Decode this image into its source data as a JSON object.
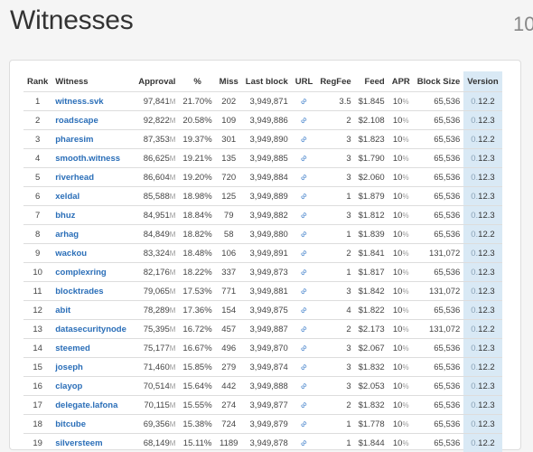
{
  "header": {
    "title": "Witnesses",
    "count": "10"
  },
  "columns": {
    "rank": "Rank",
    "witness": "Witness",
    "approval": "Approval",
    "pct": "%",
    "miss": "Miss",
    "last_block": "Last block",
    "url": "URL",
    "regfee": "RegFee",
    "feed": "Feed",
    "apr": "APR",
    "block_size": "Block Size",
    "version": "Version"
  },
  "rows": [
    {
      "rank": "1",
      "name": "witness.svk",
      "approval": "97,841",
      "unit": "M",
      "pct": "21.70%",
      "miss": "202",
      "last_block": "3,949,871",
      "regfee": "3.5",
      "feed": "$1.845",
      "apr": "10",
      "apr_unit": "%",
      "block_size": "65,536",
      "ver_major": "0.",
      "ver_minor": "12.2"
    },
    {
      "rank": "2",
      "name": "roadscape",
      "approval": "92,822",
      "unit": "M",
      "pct": "20.58%",
      "miss": "109",
      "last_block": "3,949,886",
      "regfee": "2",
      "feed": "$2.108",
      "apr": "10",
      "apr_unit": "%",
      "block_size": "65,536",
      "ver_major": "0.",
      "ver_minor": "12.3"
    },
    {
      "rank": "3",
      "name": "pharesim",
      "approval": "87,353",
      "unit": "M",
      "pct": "19.37%",
      "miss": "301",
      "last_block": "3,949,890",
      "regfee": "3",
      "feed": "$1.823",
      "apr": "10",
      "apr_unit": "%",
      "block_size": "65,536",
      "ver_major": "0.",
      "ver_minor": "12.2"
    },
    {
      "rank": "4",
      "name": "smooth.witness",
      "approval": "86,625",
      "unit": "M",
      "pct": "19.21%",
      "miss": "135",
      "last_block": "3,949,885",
      "regfee": "3",
      "feed": "$1.790",
      "apr": "10",
      "apr_unit": "%",
      "block_size": "65,536",
      "ver_major": "0.",
      "ver_minor": "12.3"
    },
    {
      "rank": "5",
      "name": "riverhead",
      "approval": "86,604",
      "unit": "M",
      "pct": "19.20%",
      "miss": "720",
      "last_block": "3,949,884",
      "regfee": "3",
      "feed": "$2.060",
      "apr": "10",
      "apr_unit": "%",
      "block_size": "65,536",
      "ver_major": "0.",
      "ver_minor": "12.3"
    },
    {
      "rank": "6",
      "name": "xeldal",
      "approval": "85,588",
      "unit": "M",
      "pct": "18.98%",
      "miss": "125",
      "last_block": "3,949,889",
      "regfee": "1",
      "feed": "$1.879",
      "apr": "10",
      "apr_unit": "%",
      "block_size": "65,536",
      "ver_major": "0.",
      "ver_minor": "12.3"
    },
    {
      "rank": "7",
      "name": "bhuz",
      "approval": "84,951",
      "unit": "M",
      "pct": "18.84%",
      "miss": "79",
      "last_block": "3,949,882",
      "regfee": "3",
      "feed": "$1.812",
      "apr": "10",
      "apr_unit": "%",
      "block_size": "65,536",
      "ver_major": "0.",
      "ver_minor": "12.3"
    },
    {
      "rank": "8",
      "name": "arhag",
      "approval": "84,849",
      "unit": "M",
      "pct": "18.82%",
      "miss": "58",
      "last_block": "3,949,880",
      "regfee": "1",
      "feed": "$1.839",
      "apr": "10",
      "apr_unit": "%",
      "block_size": "65,536",
      "ver_major": "0.",
      "ver_minor": "12.2"
    },
    {
      "rank": "9",
      "name": "wackou",
      "approval": "83,324",
      "unit": "M",
      "pct": "18.48%",
      "miss": "106",
      "last_block": "3,949,891",
      "regfee": "2",
      "feed": "$1.841",
      "apr": "10",
      "apr_unit": "%",
      "block_size": "131,072",
      "ver_major": "0.",
      "ver_minor": "12.3"
    },
    {
      "rank": "10",
      "name": "complexring",
      "approval": "82,176",
      "unit": "M",
      "pct": "18.22%",
      "miss": "337",
      "last_block": "3,949,873",
      "regfee": "1",
      "feed": "$1.817",
      "apr": "10",
      "apr_unit": "%",
      "block_size": "65,536",
      "ver_major": "0.",
      "ver_minor": "12.3"
    },
    {
      "rank": "11",
      "name": "blocktrades",
      "approval": "79,065",
      "unit": "M",
      "pct": "17.53%",
      "miss": "771",
      "last_block": "3,949,881",
      "regfee": "3",
      "feed": "$1.842",
      "apr": "10",
      "apr_unit": "%",
      "block_size": "131,072",
      "ver_major": "0.",
      "ver_minor": "12.3"
    },
    {
      "rank": "12",
      "name": "abit",
      "approval": "78,289",
      "unit": "M",
      "pct": "17.36%",
      "miss": "154",
      "last_block": "3,949,875",
      "regfee": "4",
      "feed": "$1.822",
      "apr": "10",
      "apr_unit": "%",
      "block_size": "65,536",
      "ver_major": "0.",
      "ver_minor": "12.3"
    },
    {
      "rank": "13",
      "name": "datasecuritynode",
      "approval": "75,395",
      "unit": "M",
      "pct": "16.72%",
      "miss": "457",
      "last_block": "3,949,887",
      "regfee": "2",
      "feed": "$2.173",
      "apr": "10",
      "apr_unit": "%",
      "block_size": "131,072",
      "ver_major": "0.",
      "ver_minor": "12.2"
    },
    {
      "rank": "14",
      "name": "steemed",
      "approval": "75,177",
      "unit": "M",
      "pct": "16.67%",
      "miss": "496",
      "last_block": "3,949,870",
      "regfee": "3",
      "feed": "$2.067",
      "apr": "10",
      "apr_unit": "%",
      "block_size": "65,536",
      "ver_major": "0.",
      "ver_minor": "12.3"
    },
    {
      "rank": "15",
      "name": "joseph",
      "approval": "71,460",
      "unit": "M",
      "pct": "15.85%",
      "miss": "279",
      "last_block": "3,949,874",
      "regfee": "3",
      "feed": "$1.832",
      "apr": "10",
      "apr_unit": "%",
      "block_size": "65,536",
      "ver_major": "0.",
      "ver_minor": "12.2"
    },
    {
      "rank": "16",
      "name": "clayop",
      "approval": "70,514",
      "unit": "M",
      "pct": "15.64%",
      "miss": "442",
      "last_block": "3,949,888",
      "regfee": "3",
      "feed": "$2.053",
      "apr": "10",
      "apr_unit": "%",
      "block_size": "65,536",
      "ver_major": "0.",
      "ver_minor": "12.3"
    },
    {
      "rank": "17",
      "name": "delegate.lafona",
      "approval": "70,115",
      "unit": "M",
      "pct": "15.55%",
      "miss": "274",
      "last_block": "3,949,877",
      "regfee": "2",
      "feed": "$1.832",
      "apr": "10",
      "apr_unit": "%",
      "block_size": "65,536",
      "ver_major": "0.",
      "ver_minor": "12.3"
    },
    {
      "rank": "18",
      "name": "bitcube",
      "approval": "69,356",
      "unit": "M",
      "pct": "15.38%",
      "miss": "724",
      "last_block": "3,949,879",
      "regfee": "1",
      "feed": "$1.778",
      "apr": "10",
      "apr_unit": "%",
      "block_size": "65,536",
      "ver_major": "0.",
      "ver_minor": "12.3"
    },
    {
      "rank": "19",
      "name": "silversteem",
      "approval": "68,149",
      "unit": "M",
      "pct": "15.11%",
      "miss": "1189",
      "last_block": "3,949,878",
      "regfee": "1",
      "feed": "$1.844",
      "apr": "10",
      "apr_unit": "%",
      "block_size": "65,536",
      "ver_major": "0.",
      "ver_minor": "12.2"
    }
  ],
  "icons": {
    "url": "link-icon"
  },
  "colors": {
    "link": "#2a6eb8",
    "version_bg": "#d9e9f5"
  }
}
